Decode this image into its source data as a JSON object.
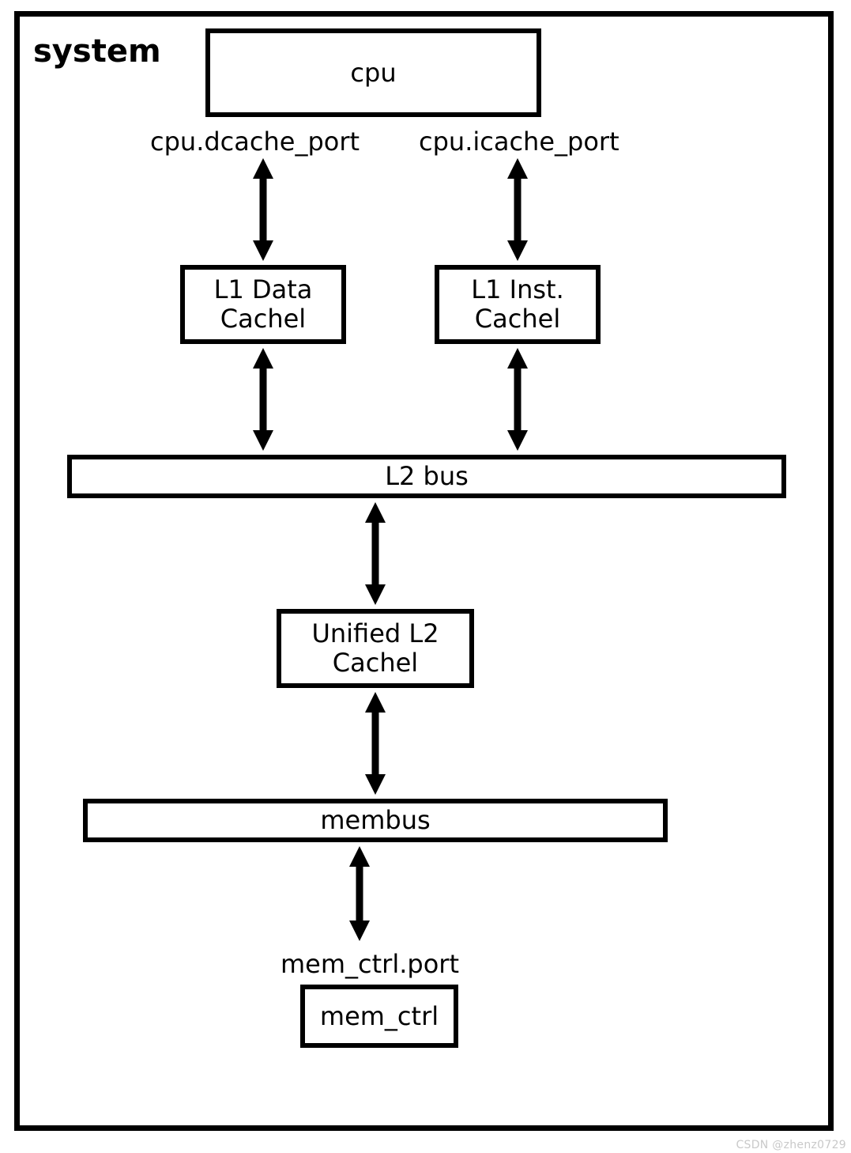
{
  "system_title": "system",
  "nodes": {
    "cpu": "cpu",
    "l1d": "L1 Data\nCachel",
    "l1i": "L1 Inst.\nCachel",
    "l2bus": "L2 bus",
    "l2cache": "Unified L2\nCachel",
    "membus": "membus",
    "memctrl": "mem_ctrl"
  },
  "port_labels": {
    "dcache": "cpu.dcache_port",
    "icache": "cpu.icache_port",
    "memctrl": "mem_ctrl.port"
  },
  "watermark": "CSDN @zhenz0729"
}
